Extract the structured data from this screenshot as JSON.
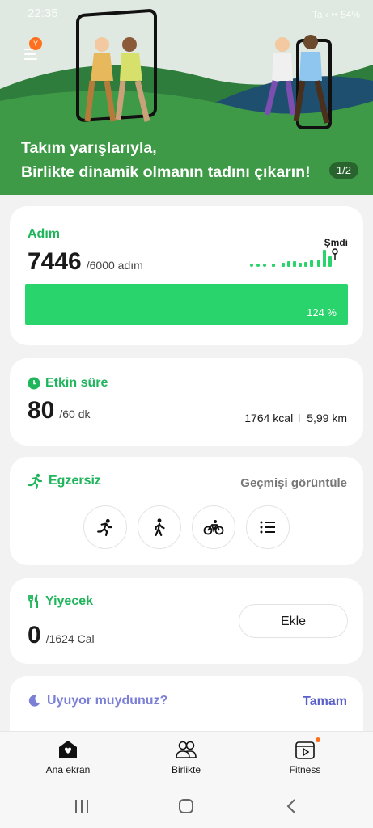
{
  "status_bar": {
    "time": "22:35",
    "right_text": "Ta ‹ •• 54%"
  },
  "banner": {
    "avatar_letter": "Y",
    "headline_line1": "Takım yarışlarıyla,",
    "headline_line2": "Birlikte dinamik olmanın tadını çıkarın!",
    "page_indicator": "1/2",
    "colors": {
      "grass": "#3f9a47",
      "sky": "#dfe9e2",
      "hill": "#2b6f3a"
    }
  },
  "steps_card": {
    "title": "Adım",
    "value": "7446",
    "goal": "/6000 adım",
    "now_label": "Şmdi",
    "percent_label": "124 %",
    "progress_fraction": 1.0,
    "accent": "#2ad46c"
  },
  "active_card": {
    "title": "Etkin süre",
    "value": "80",
    "goal": "/60 dk",
    "kcal": "1764 kcal",
    "distance": "5,99 km"
  },
  "exercise_card": {
    "title": "Egzersiz",
    "history_link": "Geçmişi görüntüle",
    "buttons": [
      {
        "icon": "running-icon"
      },
      {
        "icon": "walking-icon"
      },
      {
        "icon": "cycling-icon"
      },
      {
        "icon": "list-icon"
      }
    ]
  },
  "food_card": {
    "title": "Yiyecek",
    "value": "0",
    "goal": "/1624 Cal",
    "add_label": "Ekle"
  },
  "sleep_card": {
    "title": "Uyuyor muydunuz?",
    "confirm_label": "Tamam"
  },
  "bottom_nav": {
    "items": [
      {
        "label": "Ana ekran",
        "icon": "home-icon"
      },
      {
        "label": "Birlikte",
        "icon": "people-icon"
      },
      {
        "label": "Fitness",
        "icon": "fitness-icon"
      }
    ]
  }
}
